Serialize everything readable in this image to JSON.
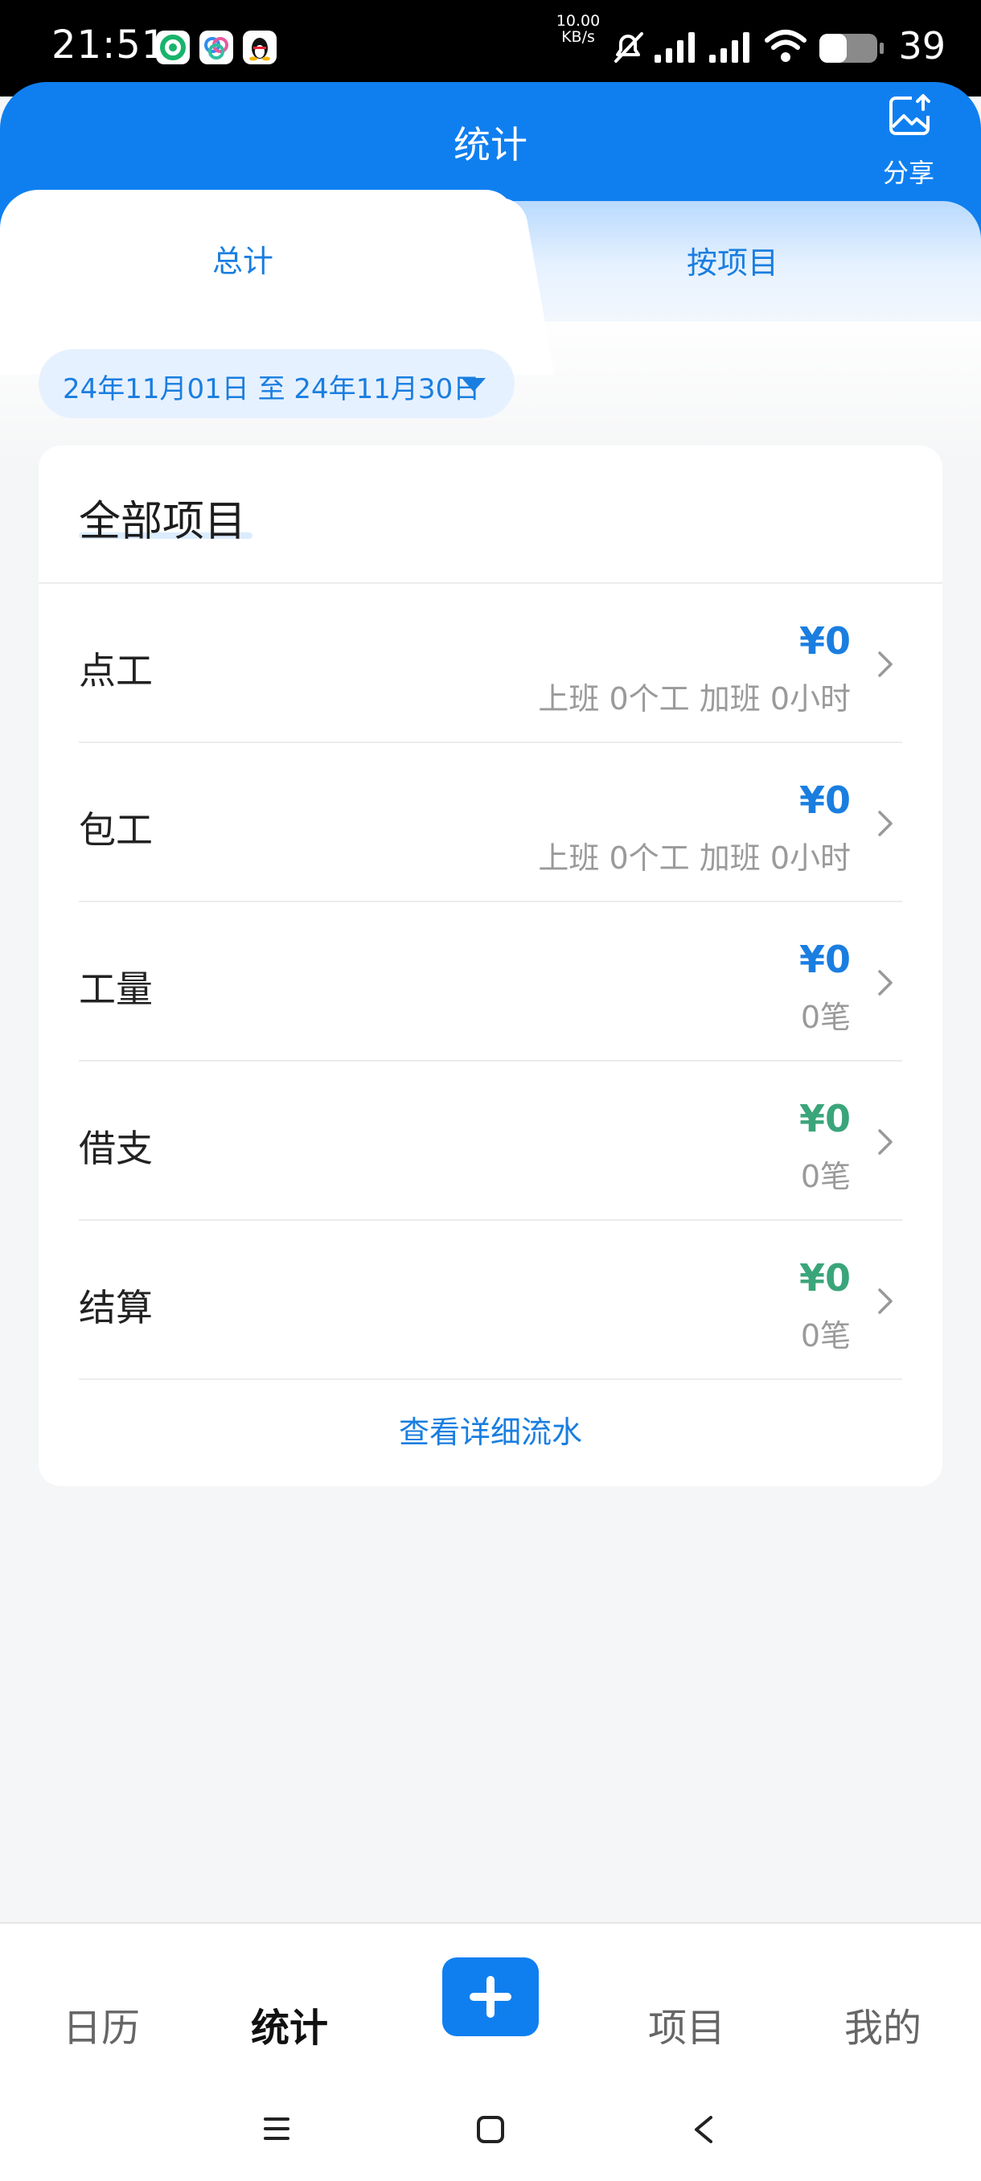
{
  "status_bar": {
    "time": "21:51",
    "net_speed_value": "10.00",
    "net_speed_unit": "KB/s",
    "battery_level": "39",
    "icons": [
      "app-green-icon",
      "app-cloud-icon",
      "qq-penguin-icon",
      "mute-icon",
      "signal-icon",
      "signal-icon",
      "wifi-icon",
      "battery-icon"
    ]
  },
  "header": {
    "title": "统计",
    "share_label": "分享"
  },
  "tabs": [
    {
      "label": "总计",
      "active": true
    },
    {
      "label": "按项目",
      "active": false
    }
  ],
  "date_range": {
    "text": "24年11月01日 至 24年11月30日"
  },
  "card": {
    "title": "全部项目",
    "rows": [
      {
        "label": "点工",
        "amount": "¥0",
        "sub": "上班 0个工 加班 0小时",
        "amount_color": "#1a7ee0"
      },
      {
        "label": "包工",
        "amount": "¥0",
        "sub": "上班 0个工 加班 0小时",
        "amount_color": "#1a7ee0"
      },
      {
        "label": "工量",
        "amount": "¥0",
        "sub": "0笔",
        "amount_color": "#1a7ee0"
      },
      {
        "label": "借支",
        "amount": "¥0",
        "sub": "0笔",
        "amount_color": "#3aa57a"
      },
      {
        "label": "结算",
        "amount": "¥0",
        "sub": "0笔",
        "amount_color": "#3aa57a"
      }
    ],
    "detail_link": "查看详细流水"
  },
  "bottom_nav": {
    "items": [
      {
        "label": "日历",
        "active": false
      },
      {
        "label": "统计",
        "active": true
      },
      {
        "label": "项目",
        "active": false
      },
      {
        "label": "我的",
        "active": false
      }
    ],
    "add_icon": "plus-icon"
  },
  "colors": {
    "primary": "#0f7ff0",
    "link": "#1a7ee0",
    "income_green": "#3aa57a"
  }
}
